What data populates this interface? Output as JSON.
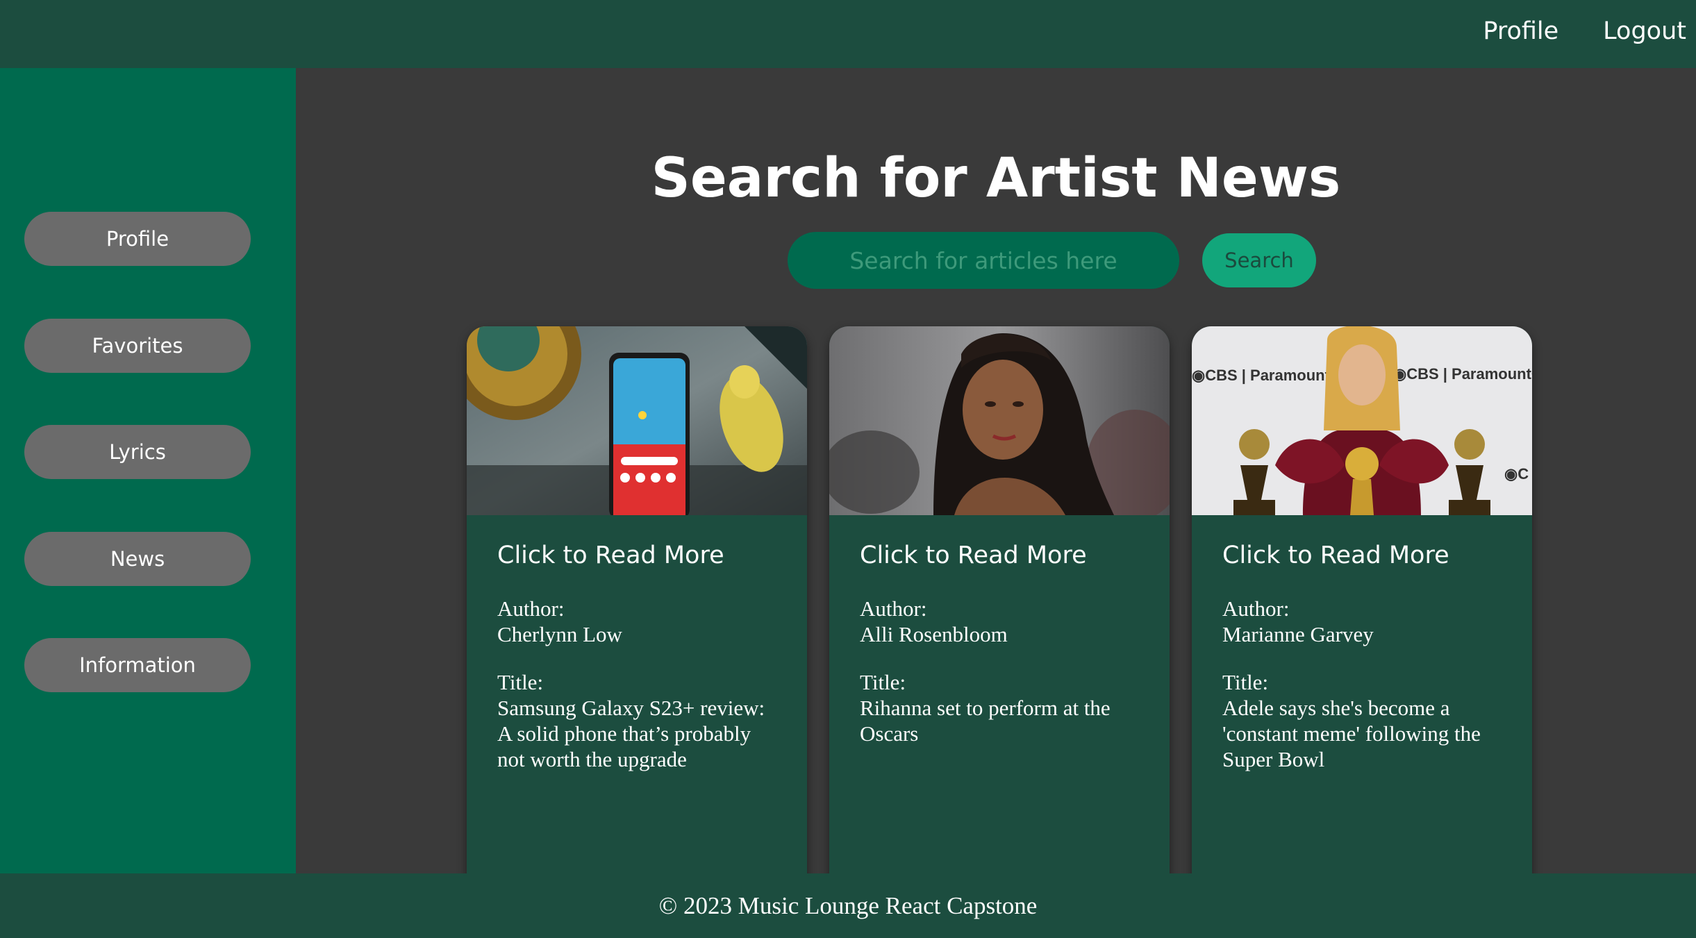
{
  "header": {
    "nav": [
      "Profile",
      "Logout"
    ]
  },
  "sidebar": {
    "items": [
      {
        "label": "Profile"
      },
      {
        "label": "Favorites"
      },
      {
        "label": "Lyrics"
      },
      {
        "label": "News"
      },
      {
        "label": "Information"
      }
    ]
  },
  "main": {
    "title": "Search for Artist News",
    "search_placeholder": "Search for articles here",
    "search_button": "Search"
  },
  "cards": [
    {
      "link_text": "Click to Read More",
      "author_label": "Author:",
      "author": "Cherlynn Low",
      "title_label": "Title:",
      "title": "Samsung Galaxy S23+ review: A solid phone that’s probably not worth the upgrade"
    },
    {
      "link_text": "Click to Read More",
      "author_label": "Author:",
      "author": "Alli Rosenbloom",
      "title_label": "Title:",
      "title": "Rihanna set to perform at the Oscars"
    },
    {
      "link_text": "Click to Read More",
      "author_label": "Author:",
      "author": "Marianne Garvey",
      "title_label": "Title:",
      "title": "Adele says she's become a 'constant meme' following the Super Bowl"
    }
  ],
  "footer": {
    "text": "© 2023 Music Lounge React Capstone"
  }
}
